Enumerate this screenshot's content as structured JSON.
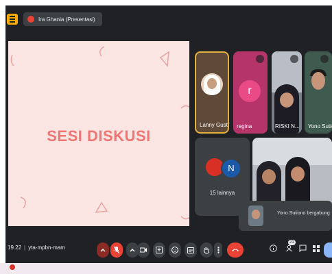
{
  "topbar": {
    "presenter_label": "Ira Ghania (Presentasi)"
  },
  "presentation": {
    "slide_title": "SESI DISKUSI"
  },
  "participants": [
    {
      "name": "Lanny Gust...",
      "speaking": true
    },
    {
      "name": "regina",
      "avatar_letter": "r",
      "avatar_color": "#ea4b87"
    },
    {
      "name": "RISKI N..."
    },
    {
      "name": "Yono Sutiono"
    }
  ],
  "others": {
    "avatar_letter": "N",
    "count_label": "15 lainnya"
  },
  "toast": {
    "message": "Yono Sutiono bergabung"
  },
  "meeting": {
    "time": "19.22",
    "code": "yta-mpbn-mam"
  },
  "controls": {
    "participant_count": "21",
    "icons": [
      "chevron-up-icon",
      "mic-off-icon",
      "chevron-up-icon",
      "camera-icon",
      "present-icon",
      "emoji-icon",
      "captions-icon",
      "raise-hand-icon",
      "more-icon",
      "end-call-icon",
      "info-icon",
      "people-icon",
      "chat-icon",
      "activities-icon"
    ]
  },
  "colors": {
    "accent_red": "#ea4335",
    "slide_bg": "#fbe5e2",
    "slide_title": "#f07573",
    "speaking_border": "#e3b341"
  }
}
